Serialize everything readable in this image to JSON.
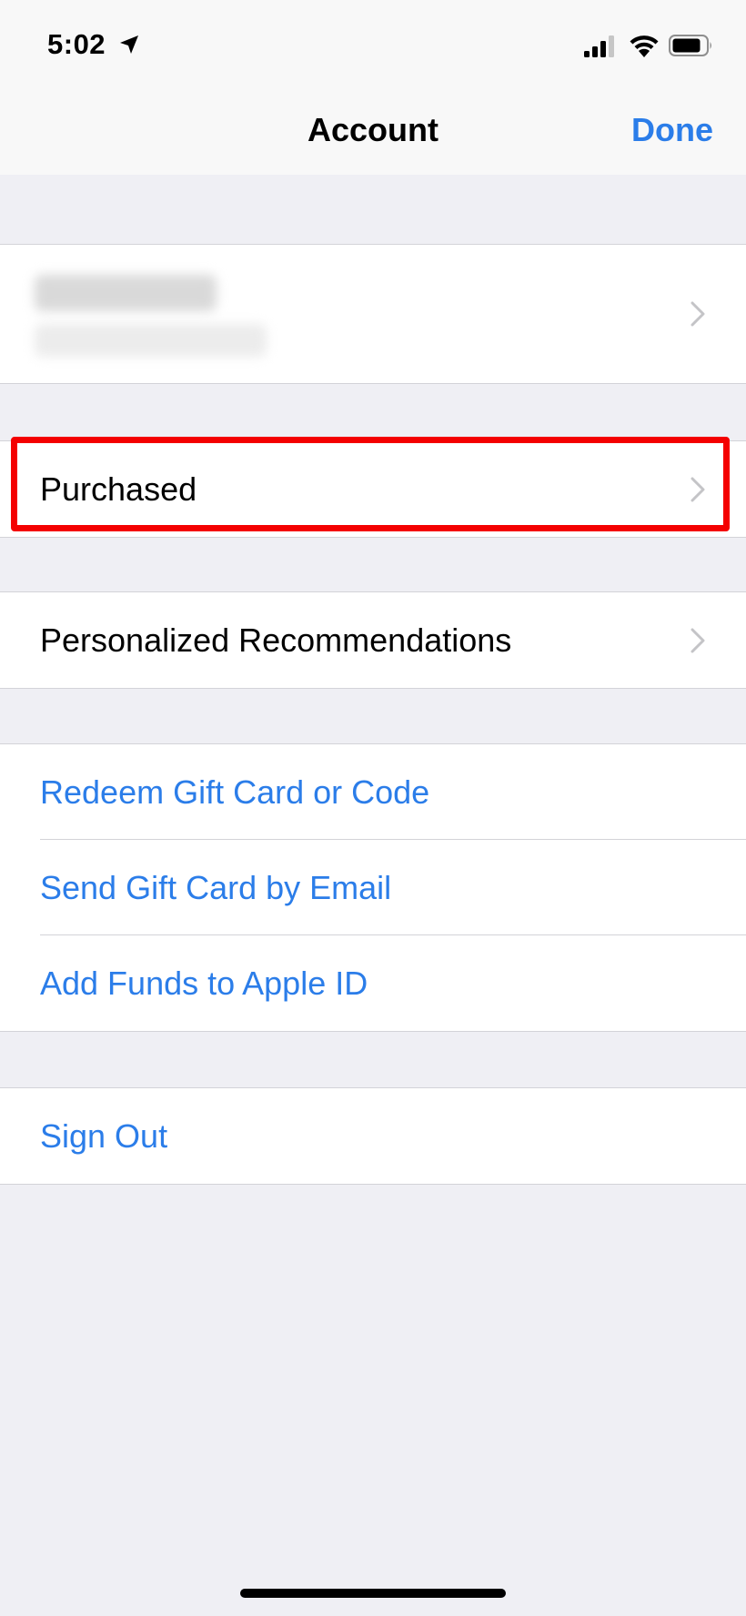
{
  "status_bar": {
    "time": "5:02",
    "icons": [
      "location-arrow-icon",
      "cellular-signal-icon",
      "wifi-icon",
      "battery-icon"
    ]
  },
  "nav": {
    "title": "Account",
    "done_label": "Done"
  },
  "rows": {
    "purchased": "Purchased",
    "personalized": "Personalized Recommendations",
    "redeem": "Redeem Gift Card or Code",
    "send_gift": "Send Gift Card by Email",
    "add_funds": "Add Funds to Apple ID",
    "sign_out": "Sign Out"
  },
  "colors": {
    "accent": "#2b7de9",
    "highlight": "#f40000",
    "background": "#efeff4"
  }
}
